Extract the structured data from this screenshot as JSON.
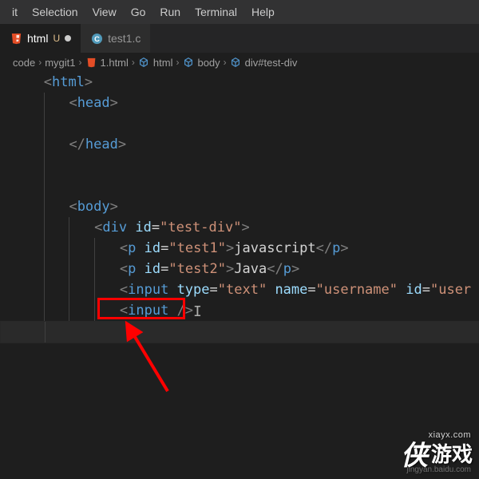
{
  "menu": {
    "items": [
      "it",
      "Selection",
      "View",
      "Go",
      "Run",
      "Terminal",
      "Help"
    ]
  },
  "tabs": {
    "active": {
      "name": "html",
      "status_letter": "U"
    },
    "other": {
      "name": "test1.c"
    }
  },
  "breadcrumbs": {
    "0": "code",
    "1": "mygit1",
    "2": "1.html",
    "3": "html",
    "4": "body",
    "5": "div#test-div"
  },
  "code": {
    "l0": {
      "b1": "<",
      "t": "html",
      "b2": ">"
    },
    "l1": {
      "b1": "<",
      "t": "head",
      "b2": ">"
    },
    "l2": {
      "b1": "</",
      "t": "head",
      "b2": ">"
    },
    "l3": {
      "b1": "<",
      "t": "body",
      "b2": ">"
    },
    "l4": {
      "b1": "<",
      "t": "div",
      "sp": " ",
      "a": "id",
      "eq": "=",
      "s": "\"test-div\"",
      "b2": ">"
    },
    "l5": {
      "b1": "<",
      "t": "p",
      "sp": " ",
      "a": "id",
      "eq": "=",
      "s": "\"test1\"",
      "b2": ">",
      "txt": "javascript",
      "b3": "</",
      "t2": "p",
      "b4": ">"
    },
    "l6": {
      "b1": "<",
      "t": "p",
      "sp": " ",
      "a": "id",
      "eq": "=",
      "s": "\"test2\"",
      "b2": ">",
      "txt": "Java",
      "b3": "</",
      "t2": "p",
      "b4": ">"
    },
    "l7": {
      "b1": "<",
      "t": "input",
      "sp": " ",
      "a1": "type",
      "eq1": "=",
      "s1": "\"text\"",
      "sp2": " ",
      "a2": "name",
      "eq2": "=",
      "s2": "\"username\"",
      "sp3": " ",
      "a3": "id",
      "eq3": "=",
      "s3": "\"user"
    },
    "l8": {
      "b1": "<",
      "t": "input",
      "sp": " ",
      "b2": "/>"
    }
  },
  "watermark": {
    "logo": "侠",
    "cn": "游戏",
    "url": "xiayx.com",
    "sub": "jingyan.baidu.com"
  }
}
